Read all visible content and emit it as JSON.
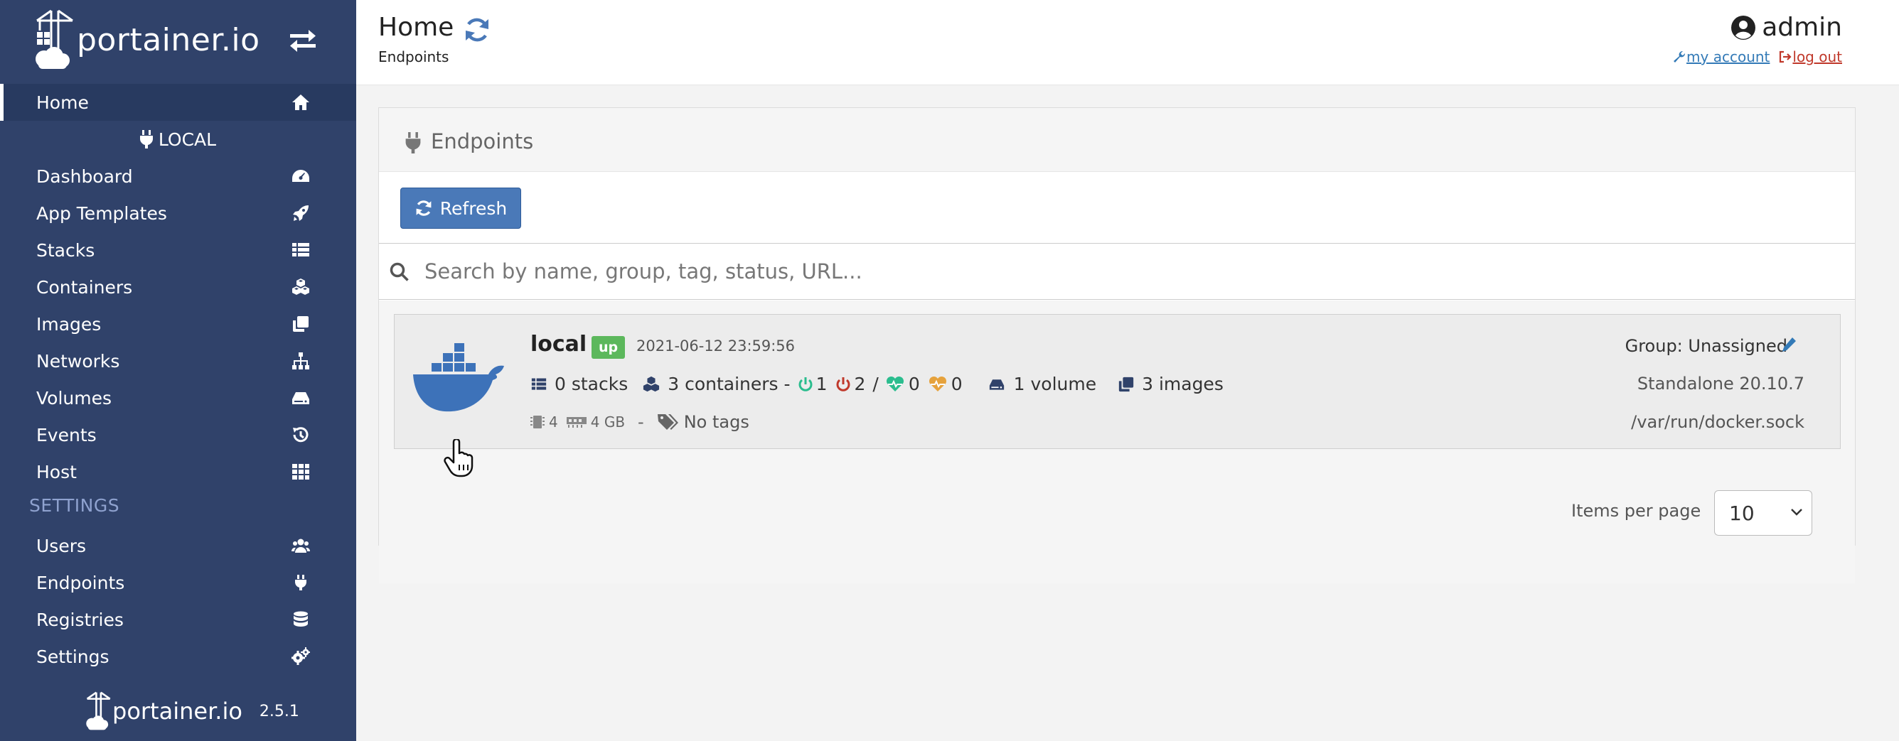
{
  "app": {
    "brand": "portainer.io",
    "version": "2.5.1"
  },
  "colors": {
    "sidebar": "#30426a",
    "accent": "#4a79b8",
    "status_up": "#5cb85c",
    "danger": "#c0392b",
    "healthy": "#2bbd8e",
    "unhealthy": "#e6a23c"
  },
  "sidebar": {
    "home": {
      "label": "Home",
      "icon": "home-icon"
    },
    "endpoint_header": "LOCAL",
    "endpoint_items": [
      {
        "label": "Dashboard",
        "icon": "tachometer-icon"
      },
      {
        "label": "App Templates",
        "icon": "rocket-icon"
      },
      {
        "label": "Stacks",
        "icon": "th-list-icon"
      },
      {
        "label": "Containers",
        "icon": "cubes-icon"
      },
      {
        "label": "Images",
        "icon": "clone-icon"
      },
      {
        "label": "Networks",
        "icon": "sitemap-icon"
      },
      {
        "label": "Volumes",
        "icon": "hdd-icon"
      },
      {
        "label": "Events",
        "icon": "history-icon"
      },
      {
        "label": "Host",
        "icon": "th-icon"
      }
    ],
    "settings_header": "SETTINGS",
    "settings_items": [
      {
        "label": "Users",
        "icon": "users-icon"
      },
      {
        "label": "Endpoints",
        "icon": "plug-icon"
      },
      {
        "label": "Registries",
        "icon": "database-icon"
      },
      {
        "label": "Settings",
        "icon": "cogs-icon"
      }
    ]
  },
  "header": {
    "title": "Home",
    "breadcrumb": "Endpoints",
    "user": "admin",
    "my_account": "my account",
    "log_out": "log out"
  },
  "widget": {
    "title": "Endpoints",
    "refresh_label": "Refresh",
    "search_placeholder": "Search by name, group, tag, status, URL...",
    "items_per_page_label": "Items per page",
    "items_per_page_value": "10"
  },
  "endpoints": [
    {
      "name": "local",
      "status": "up",
      "timestamp": "2021-06-12 23:59:56",
      "stacks": "0 stacks",
      "containers": "3 containers -",
      "running": "1",
      "stopped": "2",
      "separator": "/",
      "healthy": "0",
      "unhealthy": "0",
      "volumes": "1 volume",
      "images": "3 images",
      "cpu": "4",
      "memory": "4 GB",
      "meta_separator": "-",
      "tags": "No tags",
      "group": "Group: Unassigned",
      "version": "Standalone 20.10.7",
      "url": "/var/run/docker.sock"
    }
  ]
}
